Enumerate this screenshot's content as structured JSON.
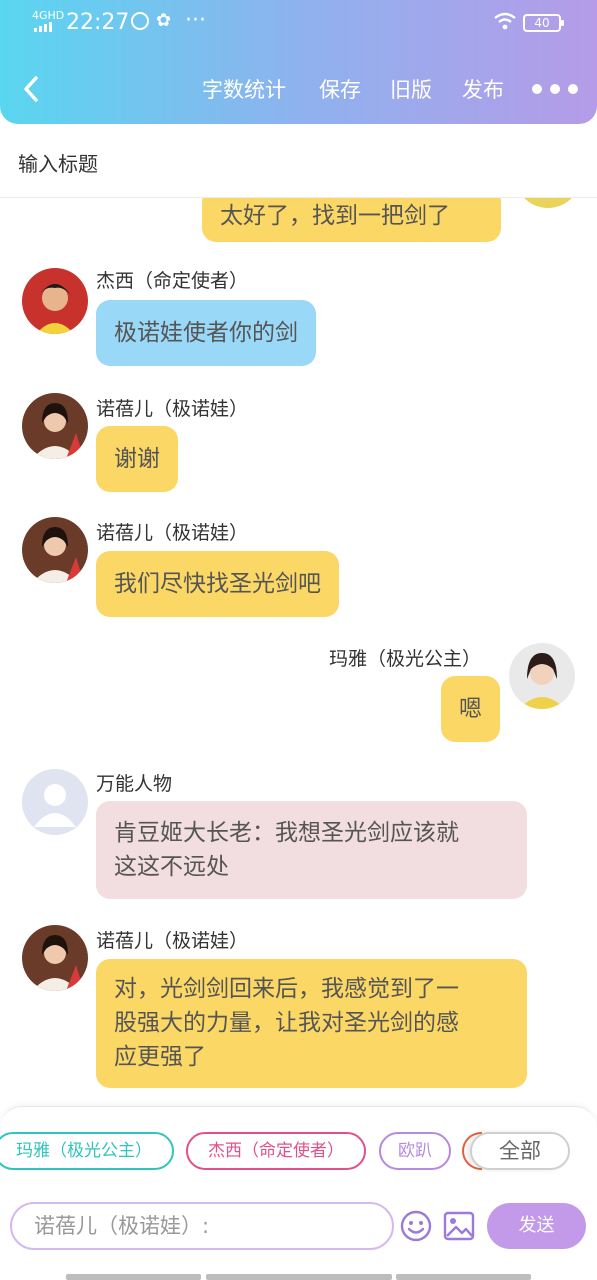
{
  "status": {
    "network": "4GHD",
    "time": "22:27",
    "battery": "40"
  },
  "toolbar": {
    "word_count": "字数统计",
    "save": "保存",
    "old_version": "旧版",
    "publish": "发布"
  },
  "title_placeholder": "输入标题",
  "messages": [
    {
      "text": "太好了，找到一把剑了"
    },
    {
      "speaker": "杰西（命定使者）",
      "text": "极诺娃使者你的剑"
    },
    {
      "speaker": "诺蓓儿（极诺娃）",
      "text": "谢谢"
    },
    {
      "speaker": "诺蓓儿（极诺娃）",
      "text": "我们尽快找圣光剑吧"
    },
    {
      "speaker": "玛雅（极光公主）",
      "text": "嗯"
    },
    {
      "speaker": "万能人物",
      "text_lines": [
        "肯豆姬大长老：我想圣光剑应该就",
        "这这不远处"
      ]
    },
    {
      "speaker": "诺蓓儿（极诺娃）",
      "text_lines": [
        "对，光剑剑回来后，我感觉到了一",
        "股强大的力量，让我对圣光剑的感",
        "应更强了"
      ]
    }
  ],
  "characters": [
    "玛雅（极光公主）",
    "杰西（命定使者）",
    "欧趴"
  ],
  "all_label": "全部",
  "input_placeholder": "诺蓓儿（极诺娃）:",
  "send_label": "发送",
  "colors": {
    "yellow_bubble": "#fbd766",
    "blue_bubble": "#9ad8f8",
    "pink_bubble": "#f2dde0",
    "accent": "#c39ae9"
  }
}
